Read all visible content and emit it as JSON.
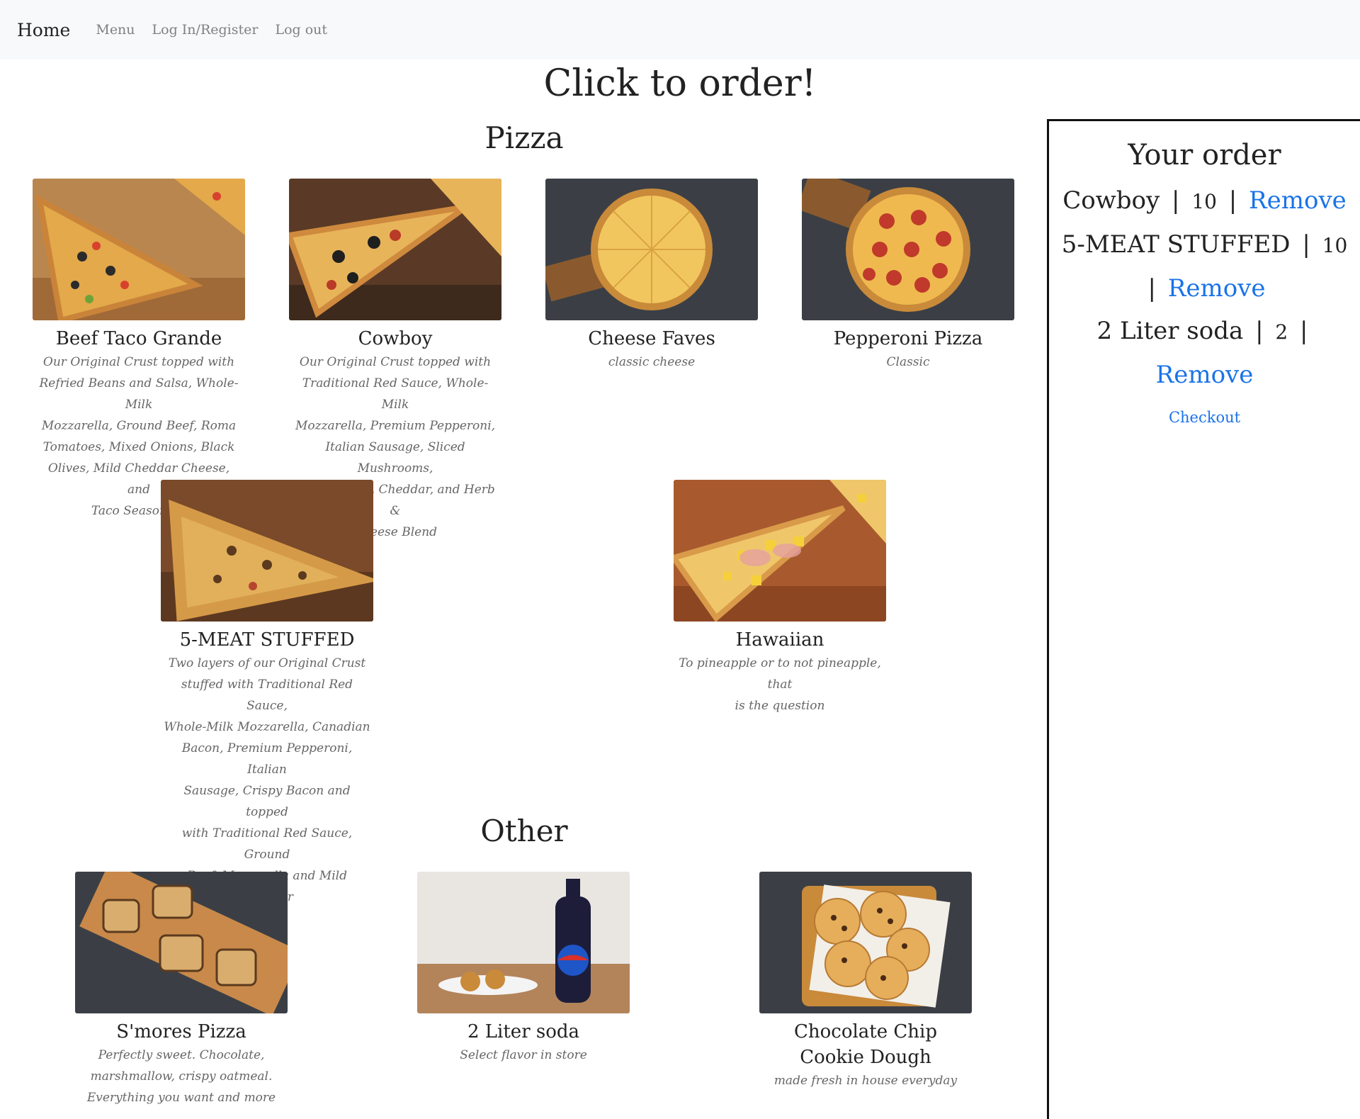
{
  "nav": {
    "brand": "Home",
    "links": [
      "Menu",
      "Log In/Register",
      "Log out"
    ]
  },
  "page_title": "Click to order!",
  "sections": {
    "pizza_title": "Pizza",
    "other_title": "Other"
  },
  "pizza": [
    {
      "name": "Beef Taco Grande",
      "desc": [
        "Our Original Crust topped with",
        "Refried Beans and Salsa, Whole-Milk",
        "Mozzarella, Ground Beef, Roma",
        "Tomatoes, Mixed Onions, Black",
        "Olives, Mild Cheddar Cheese, and",
        "Taco Seasoning"
      ]
    },
    {
      "name": "Cowboy",
      "desc": [
        "Our Original Crust topped with",
        "Traditional Red Sauce, Whole-Milk",
        "Mozzarella, Premium Pepperoni,",
        "Italian Sausage, Sliced Mushrooms,",
        "Black Olives, Cheddar, and Herb &",
        "Cheese Blend"
      ]
    },
    {
      "name": "Cheese Faves",
      "desc": [
        "classic cheese"
      ]
    },
    {
      "name": "Pepperoni Pizza",
      "desc": [
        "Classic"
      ]
    },
    {
      "name": "5-MEAT STUFFED",
      "desc": [
        "Two layers of our Original Crust",
        "stuffed with Traditional Red Sauce,",
        "Whole-Milk Mozzarella, Canadian",
        "Bacon, Premium Pepperoni, Italian",
        "Sausage, Crispy Bacon and topped",
        "with Traditional Red Sauce, Ground",
        "Beef, Mozzarella and Mild Cheddar"
      ]
    },
    {
      "name": "Hawaiian",
      "desc": [
        "To pineapple or to not pineapple, that",
        "is the question"
      ]
    }
  ],
  "other": [
    {
      "name": "S'mores Pizza",
      "desc": [
        "Perfectly sweet. Chocolate,",
        "marshmallow, crispy oatmeal.",
        "Everything you want and more"
      ]
    },
    {
      "name": "2 Liter soda",
      "desc": [
        "Select flavor in store"
      ]
    },
    {
      "name": "Chocolate Chip Cookie Dough",
      "desc": [
        "made fresh in house everyday"
      ]
    }
  ],
  "order": {
    "title": "Your order",
    "separator": "|",
    "remove_label": "Remove",
    "items": [
      {
        "name": "Cowboy",
        "qty": "10"
      },
      {
        "name": "5-MEAT STUFFED",
        "qty": "10"
      },
      {
        "name": "2 Liter soda",
        "qty": "2"
      }
    ],
    "checkout_label": "Checkout"
  },
  "colors": {
    "link": "#1a73e8",
    "nav_bg": "#f8f9fa"
  }
}
